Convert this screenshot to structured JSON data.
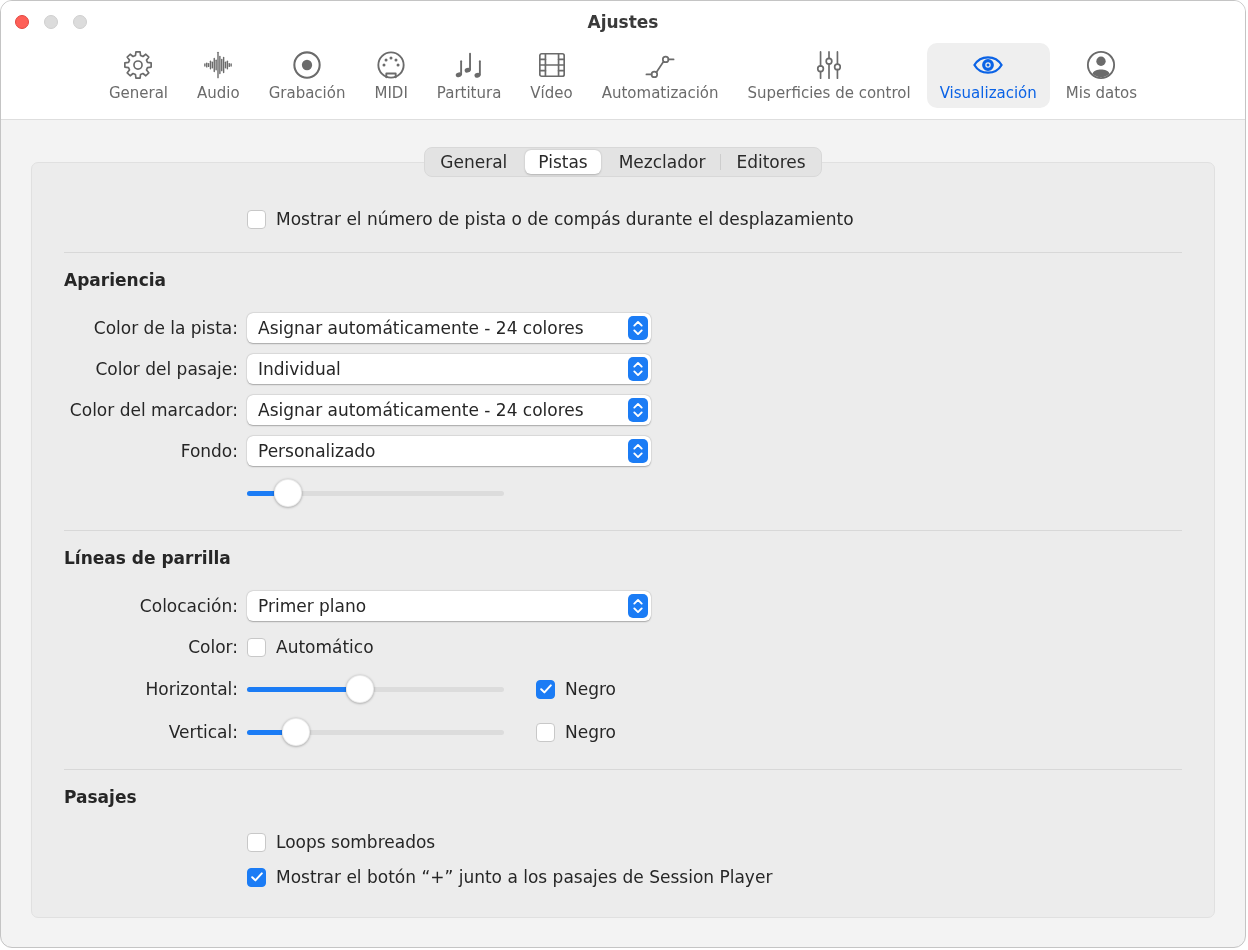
{
  "window": {
    "title": "Ajustes",
    "buttons": [
      {
        "kind": "close",
        "disabled": false
      },
      {
        "kind": "minimize",
        "disabled": true
      },
      {
        "kind": "zoom",
        "disabled": true
      }
    ]
  },
  "toolbar": {
    "items": [
      {
        "kind": "gear",
        "label": "General",
        "selected": false
      },
      {
        "kind": "waveform",
        "label": "Audio",
        "selected": false
      },
      {
        "kind": "record",
        "label": "Grabación",
        "selected": false
      },
      {
        "kind": "midi",
        "label": "MIDI",
        "selected": false
      },
      {
        "kind": "notes",
        "label": "Partitura",
        "selected": false
      },
      {
        "kind": "film",
        "label": "Vídeo",
        "selected": false
      },
      {
        "kind": "automation",
        "label": "Automatización",
        "selected": false
      },
      {
        "kind": "sliders",
        "label": "Superficies de control",
        "selected": false
      },
      {
        "kind": "eye",
        "label": "Visualización",
        "selected": true
      },
      {
        "kind": "person",
        "label": "Mis datos",
        "selected": false
      }
    ]
  },
  "tabs": [
    {
      "label": "General",
      "selected": false
    },
    {
      "label": "Pistas",
      "selected": true
    },
    {
      "label": "Mezclador",
      "selected": false
    },
    {
      "label": "Editores",
      "selected": false
    }
  ],
  "sections": [
    {
      "rows": [
        {
          "kind": "checkbox",
          "text": "Mostrar el número de pista o de compás durante el desplazamiento",
          "checked": false
        }
      ]
    },
    {
      "title": "Apariencia",
      "rows": [
        {
          "kind": "popup",
          "label": "Color de la pista:",
          "value": "Asignar automáticamente - 24 colores"
        },
        {
          "kind": "popup",
          "label": "Color del pasaje:",
          "value": "Individual"
        },
        {
          "kind": "popup",
          "label": "Color del marcador:",
          "value": "Asignar automáticamente - 24 colores"
        },
        {
          "kind": "popup",
          "label": "Fondo:",
          "value": "Personalizado"
        },
        {
          "kind": "slider",
          "level": 0.16
        }
      ]
    },
    {
      "title": "Líneas de parrilla",
      "rows": [
        {
          "kind": "popup",
          "label": "Colocación:",
          "value": "Primer plano"
        },
        {
          "kind": "checkbox",
          "label": "Color:",
          "text": "Automático",
          "checked": false
        },
        {
          "kind": "slider",
          "label": "Horizontal:",
          "level": 0.44,
          "checkbox": {
            "text": "Negro",
            "checked": true
          }
        },
        {
          "kind": "slider",
          "label": "Vertical:",
          "level": 0.19,
          "checkbox": {
            "text": "Negro",
            "checked": false
          }
        }
      ]
    },
    {
      "title": "Pasajes",
      "rows": [
        {
          "kind": "checkbox",
          "text": "Loops sombreados",
          "checked": false
        },
        {
          "kind": "checkbox",
          "text": "Mostrar el botón “+” junto a los pasajes de Session Player",
          "checked": true
        }
      ]
    }
  ]
}
